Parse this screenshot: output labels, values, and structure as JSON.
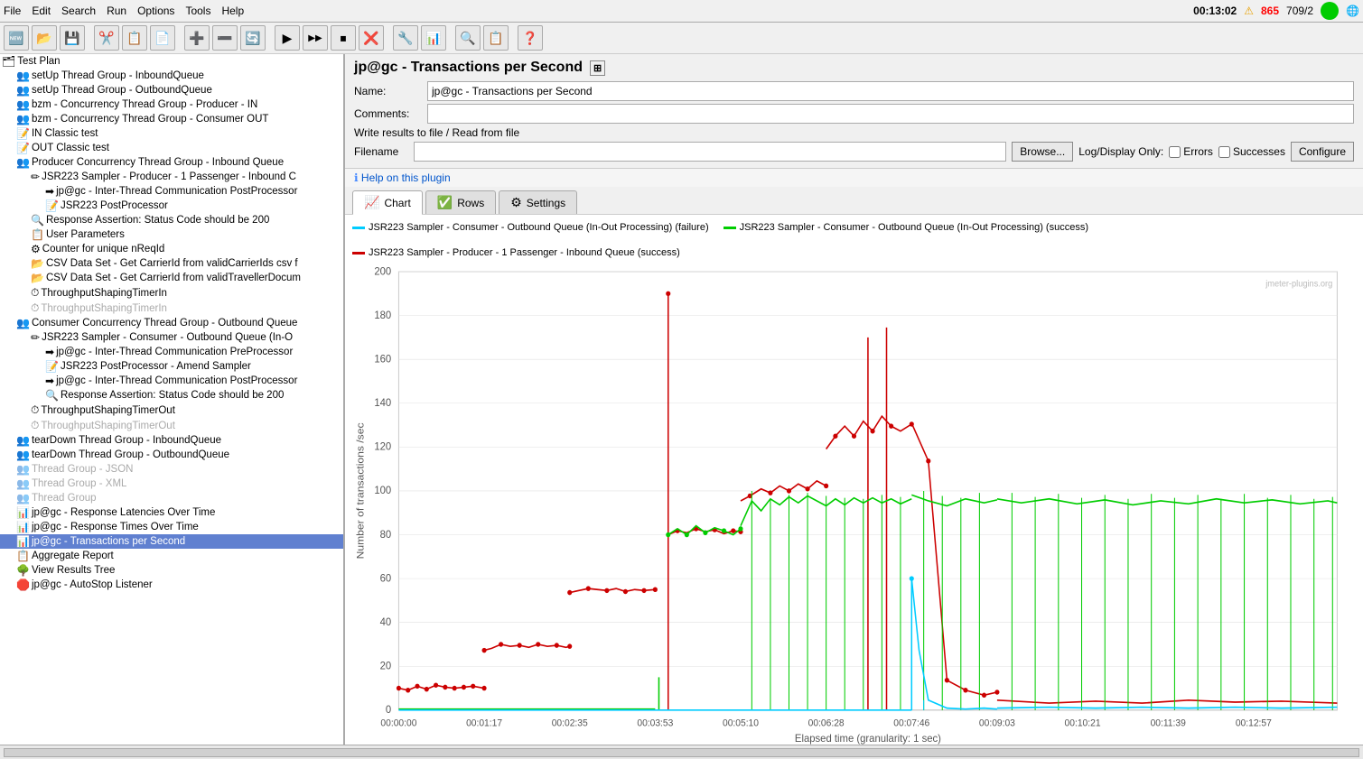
{
  "menubar": {
    "items": [
      "File",
      "Edit",
      "Search",
      "Run",
      "Options",
      "Tools",
      "Help"
    ]
  },
  "toolbar": {
    "buttons": [
      "🆕",
      "📂",
      "💾",
      "✂️",
      "📋",
      "📄",
      "➕",
      "➖",
      "🔄",
      "▶",
      "▶▶",
      "⏹",
      "❌",
      "🔧",
      "📊",
      "🔍",
      "📋",
      "❓"
    ],
    "status_time": "00:13:02",
    "warn_icon": "⚠",
    "errors_count": "865",
    "thread_count": "709/2"
  },
  "panel": {
    "title": "jp@gc - Transactions per Second",
    "name_label": "Name:",
    "name_value": "jp@gc - Transactions per Second",
    "comments_label": "Comments:",
    "comments_value": "",
    "write_results_title": "Write results to file / Read from file",
    "filename_label": "Filename",
    "filename_value": "",
    "browse_label": "Browse...",
    "log_display_label": "Log/Display Only:",
    "errors_label": "Errors",
    "successes_label": "Successes",
    "configure_label": "Configure"
  },
  "tabs": [
    {
      "id": "chart",
      "label": "Chart",
      "icon": "📈",
      "active": true
    },
    {
      "id": "rows",
      "label": "Rows",
      "icon": "✅"
    },
    {
      "id": "settings",
      "label": "Settings",
      "icon": "⚙"
    }
  ],
  "help_link": "Help on this plugin",
  "chart": {
    "legend": [
      {
        "color": "#00ccff",
        "label": "JSR223 Sampler - Consumer - Outbound Queue (In-Out Processing) (failure)"
      },
      {
        "color": "#00cc00",
        "label": "JSR223 Sampler - Consumer - Outbound Queue (In-Out Processing) (success)"
      },
      {
        "color": "#cc0000",
        "label": "JSR223 Sampler - Producer - 1 Passenger - Inbound Queue (success)"
      }
    ],
    "y_axis_label": "Number of transactions /sec",
    "x_axis_label": "Elapsed time (granularity: 1 sec)",
    "y_ticks": [
      "0",
      "20",
      "40",
      "60",
      "80",
      "100",
      "120",
      "140",
      "160",
      "180",
      "200"
    ],
    "x_ticks": [
      "00:00:00",
      "00:01:17",
      "00:02:35",
      "00:03:53",
      "00:05:10",
      "00:06:28",
      "00:07:46",
      "00:09:03",
      "00:10:21",
      "00:11:39",
      "00:12:57"
    ],
    "watermark": "jmeter-plugins.org"
  },
  "tree": {
    "items": [
      {
        "level": 0,
        "icon": "🗂",
        "label": "Test Plan",
        "expanded": true
      },
      {
        "level": 1,
        "icon": "👥",
        "label": "setUp Thread Group - InboundQueue"
      },
      {
        "level": 1,
        "icon": "👥",
        "label": "setUp Thread Group - OutboundQueue"
      },
      {
        "level": 1,
        "icon": "👥",
        "label": "bzm - Concurrency Thread Group - Producer - IN"
      },
      {
        "level": 1,
        "icon": "👥",
        "label": "bzm - Concurrency Thread Group - Consumer OUT"
      },
      {
        "level": 1,
        "icon": "📝",
        "label": "IN Classic test"
      },
      {
        "level": 1,
        "icon": "📝",
        "label": "OUT Classic test"
      },
      {
        "level": 1,
        "icon": "👥",
        "label": "Producer Concurrency Thread Group - Inbound Queue",
        "expanded": true
      },
      {
        "level": 2,
        "icon": "✏",
        "label": "JSR223 Sampler - Producer - 1 Passenger - Inbound C",
        "expanded": true
      },
      {
        "level": 3,
        "icon": "➡",
        "label": "jp@gc - Inter-Thread Communication PostProcessor"
      },
      {
        "level": 3,
        "icon": "📝",
        "label": "JSR223 PostProcessor"
      },
      {
        "level": 2,
        "icon": "🔍",
        "label": "Response Assertion: Status Code should be 200"
      },
      {
        "level": 2,
        "icon": "📋",
        "label": "User Parameters"
      },
      {
        "level": 2,
        "icon": "⚙",
        "label": "Counter for unique nReqId"
      },
      {
        "level": 2,
        "icon": "📂",
        "label": "CSV Data Set - Get CarrierId from validCarrierIds csv f"
      },
      {
        "level": 2,
        "icon": "📂",
        "label": "CSV Data Set - Get CarrierId from validTravellerDocum"
      },
      {
        "level": 2,
        "icon": "⏱",
        "label": "ThroughputShapingTimerIn"
      },
      {
        "level": 2,
        "icon": "⏱",
        "label": "ThroughputShapingTimerIn",
        "disabled": true
      },
      {
        "level": 1,
        "icon": "👥",
        "label": "Consumer Concurrency Thread Group - Outbound Queue",
        "expanded": true
      },
      {
        "level": 2,
        "icon": "✏",
        "label": "JSR223 Sampler - Consumer - Outbound Queue (In-O",
        "expanded": true
      },
      {
        "level": 3,
        "icon": "➡",
        "label": "jp@gc - Inter-Thread Communication PreProcessor"
      },
      {
        "level": 3,
        "icon": "📝",
        "label": "JSR223 PostProcessor - Amend Sampler"
      },
      {
        "level": 3,
        "icon": "➡",
        "label": "jp@gc - Inter-Thread Communication PostProcessor"
      },
      {
        "level": 3,
        "icon": "🔍",
        "label": "Response Assertion: Status Code should be 200"
      },
      {
        "level": 2,
        "icon": "⏱",
        "label": "ThroughputShapingTimerOut"
      },
      {
        "level": 2,
        "icon": "⏱",
        "label": "ThroughputShapingTimerOut",
        "disabled": true
      },
      {
        "level": 1,
        "icon": "👥",
        "label": "tearDown Thread Group - InboundQueue"
      },
      {
        "level": 1,
        "icon": "👥",
        "label": "tearDown Thread Group - OutboundQueue"
      },
      {
        "level": 1,
        "icon": "👥",
        "label": "Thread Group - JSON",
        "disabled": true
      },
      {
        "level": 1,
        "icon": "👥",
        "label": "Thread Group - XML",
        "disabled": true
      },
      {
        "level": 1,
        "icon": "👥",
        "label": "Thread Group",
        "disabled": true
      },
      {
        "level": 1,
        "icon": "📊",
        "label": "jp@gc - Response Latencies Over Time"
      },
      {
        "level": 1,
        "icon": "📊",
        "label": "jp@gc - Response Times Over Time"
      },
      {
        "level": 1,
        "icon": "📊",
        "label": "jp@gc - Transactions per Second",
        "selected": true
      },
      {
        "level": 1,
        "icon": "📋",
        "label": "Aggregate Report"
      },
      {
        "level": 1,
        "icon": "🌳",
        "label": "View Results Tree"
      },
      {
        "level": 1,
        "icon": "🛑",
        "label": "jp@gc - AutoStop Listener"
      }
    ]
  }
}
